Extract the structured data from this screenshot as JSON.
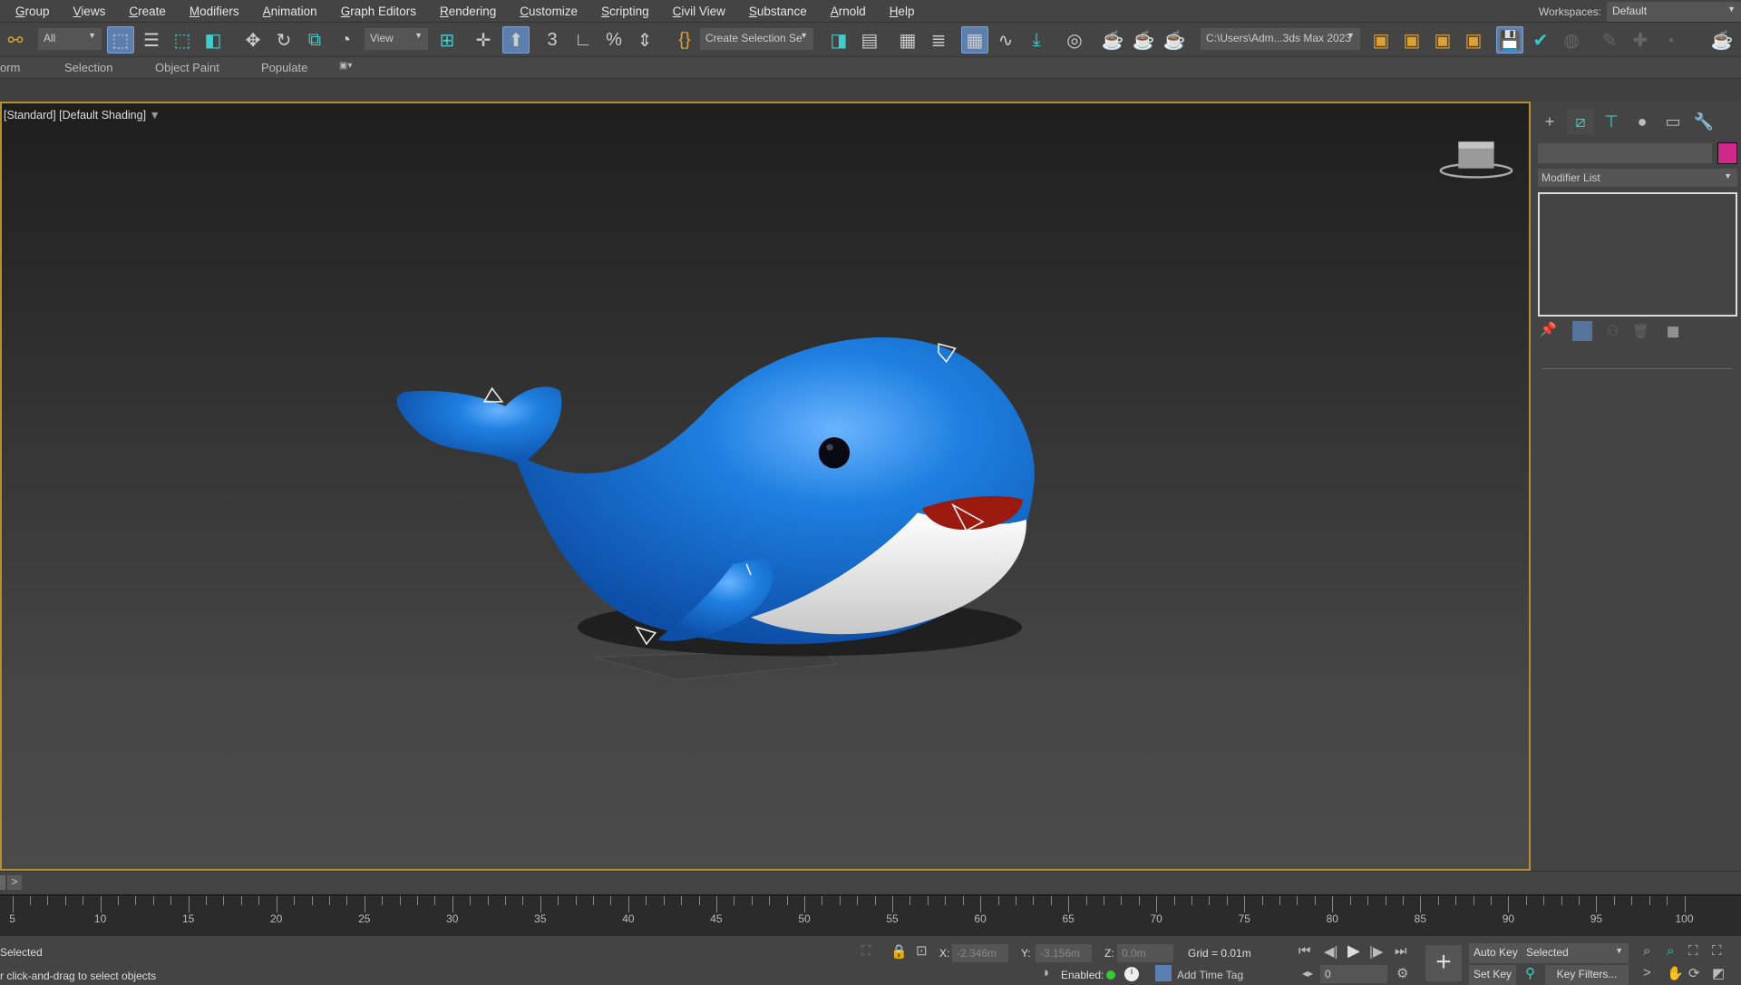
{
  "menubar": {
    "items": [
      "Group",
      "Views",
      "Create",
      "Modifiers",
      "Animation",
      "Graph Editors",
      "Rendering",
      "Customize",
      "Scripting",
      "Civil View",
      "Substance",
      "Arnold",
      "Help"
    ],
    "workspaces_label": "Workspaces:",
    "workspace_value": "Default"
  },
  "toolbar": {
    "selection_filter": "All",
    "reference_coord": "View",
    "named_selection": "Create Selection Se",
    "project_path": "C:\\Users\\Adm...3ds Max 2023"
  },
  "ribbon": {
    "tabs": [
      "orm",
      "Selection",
      "Object Paint",
      "Populate"
    ]
  },
  "viewport": {
    "label": "[Standard] [Default Shading]",
    "whale_colors": {
      "body": "#1e7fe0",
      "belly": "#f2f2f2",
      "mouth": "#9a1a10",
      "eye": "#0a0a14"
    }
  },
  "command_panel": {
    "modifier_list": "Modifier List",
    "object_color": "#d0288a"
  },
  "timeline": {
    "slider_next": ">",
    "tick_labels": [
      5,
      10,
      15,
      20,
      25,
      30,
      35,
      40,
      45,
      50,
      55,
      60,
      65,
      70,
      75,
      80,
      85,
      90,
      95,
      100
    ]
  },
  "status": {
    "selection": "Selected",
    "prompt": "r click-and-drag to select objects",
    "x_label": "X:",
    "x_value": "-2.346m",
    "y_label": "Y:",
    "y_value": "-3.156m",
    "z_label": "Z:",
    "z_value": "0.0m",
    "grid": "Grid = 0.01m",
    "enabled_label": "Enabled:",
    "add_time_tag": "Add Time Tag",
    "frame_value": "0",
    "auto_key": "Auto Key",
    "set_key": "Set Key",
    "key_mode": "Selected",
    "key_filters": "Key Filters..."
  }
}
